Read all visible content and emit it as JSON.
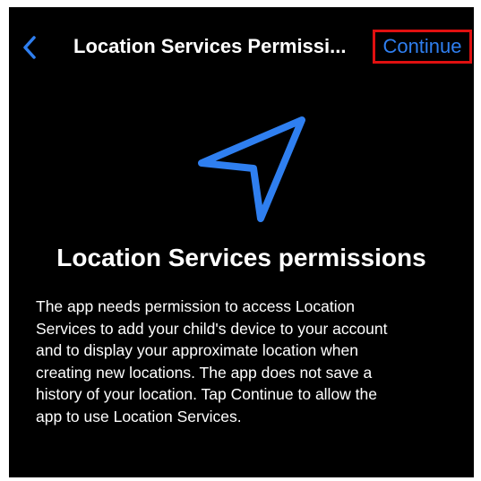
{
  "nav": {
    "back_icon": "chevron-left-icon",
    "title": "Location Services Permissi...",
    "continue_label": "Continue"
  },
  "hero": {
    "icon": "location-arrow-icon"
  },
  "content": {
    "headline": "Location Services permissions",
    "body": "The app needs permission to access Location\nServices to add your child's device to your account\nand to display your approximate location when\ncreating new locations. The app does not save a\nhistory of your location. Tap Continue to allow the\napp to use Location Services."
  },
  "colors": {
    "background": "#000000",
    "accent": "#2f7ff0",
    "highlight_border": "#e01010",
    "text": "#ffffff"
  }
}
